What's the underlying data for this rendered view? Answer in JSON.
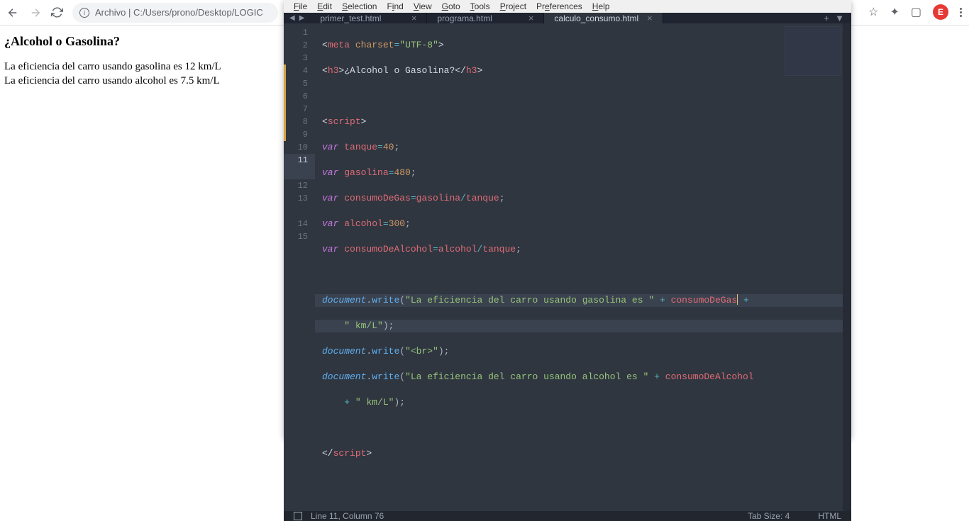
{
  "browser": {
    "url_prefix": "Archivo",
    "url_path": "C:/Users/prono/Desktop/LOGIC",
    "avatar_letter": "E"
  },
  "page": {
    "heading": "¿Alcohol o Gasolina?",
    "line1": "La eficiencia del carro usando gasolina es 12 km/L",
    "line2": "La eficiencia del carro usando alcohol es 7.5 km/L"
  },
  "menus": {
    "file": "File",
    "edit": "Edit",
    "selection": "Selection",
    "find": "Find",
    "view": "View",
    "goto": "Goto",
    "tools": "Tools",
    "project": "Project",
    "preferences": "Preferences",
    "help": "Help"
  },
  "tabs": {
    "t1": "primer_test.html",
    "t2": "programa.html",
    "t3": "calculo_consumo.html"
  },
  "code": {
    "lines": [
      "1",
      "2",
      "3",
      "4",
      "5",
      "6",
      "7",
      "8",
      "9",
      "10",
      "11",
      "",
      "12",
      "13",
      "",
      "14",
      "15"
    ]
  },
  "status": {
    "pos": "Line 11, Column 76",
    "tabsize": "Tab Size: 4",
    "lang": "HTML"
  }
}
